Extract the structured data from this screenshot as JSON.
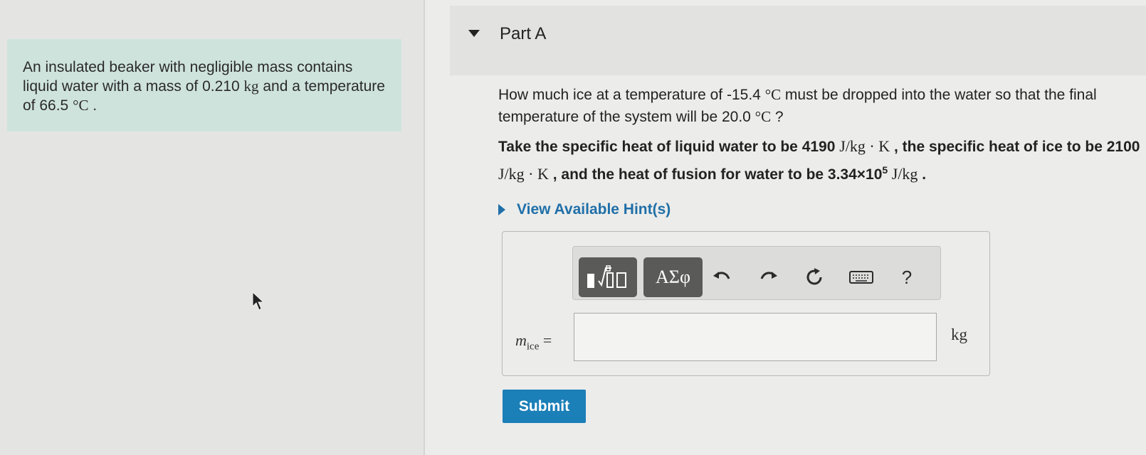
{
  "problem": {
    "text_1": "An insulated beaker with negligible mass contains liquid water with a mass of 0.210 ",
    "mass_unit": "kg",
    "text_2": " and a temperature of 66.5 ",
    "temp_unit": "°C",
    "text_3": " ."
  },
  "part": {
    "title": "Part A"
  },
  "question": {
    "q1": "How much ice at a temperature of -15.4 ",
    "q1_unit": "°C",
    "q2": " must be dropped into the water so that the final temperature of the system will be 20.0 ",
    "q2_unit": "°C",
    "q3": " ?"
  },
  "info": {
    "a": "Take the specific heat of liquid water to be 4190 ",
    "a_unit": "J/kg · K",
    "b": " , the specific heat of ice to be 2100 ",
    "b_unit": "J/kg · K",
    "c": " , and the heat of fusion for water to be 3.34×10",
    "c_exp": "5",
    "c_unit": " J/kg",
    "d": " ."
  },
  "hint": {
    "label": "View Available Hint(s)"
  },
  "toolbar": {
    "templates_label": "▮√▯",
    "greek_label": "ΑΣφ",
    "undo_icon": "undo-icon",
    "redo_icon": "redo-icon",
    "reset_icon": "reset-icon",
    "keyboard_icon": "keyboard-icon",
    "help_label": "?"
  },
  "answer": {
    "variable": "m",
    "variable_sub": "ice",
    "equals": " =",
    "value": "",
    "unit": "kg"
  },
  "submit": {
    "label": "Submit"
  },
  "colors": {
    "accent": "#1b7fb8",
    "link": "#1f6fa8",
    "problem_bg": "#cfe3dd"
  }
}
